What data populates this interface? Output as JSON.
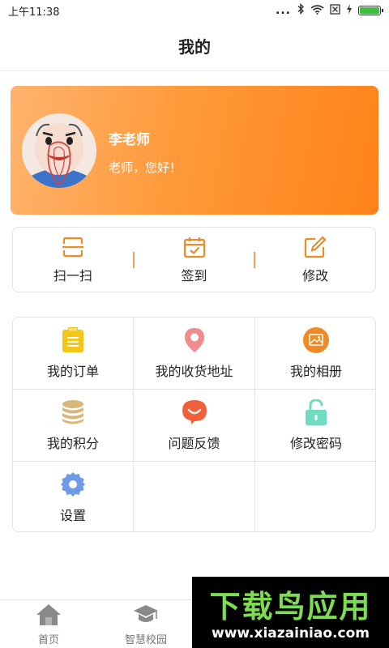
{
  "status_bar": {
    "time": "上午11:38",
    "dots": "..."
  },
  "header": {
    "title": "我的"
  },
  "profile": {
    "name": "李老师",
    "greeting": "老师，您好！"
  },
  "quick_actions": [
    {
      "label": "扫一扫",
      "icon": "scan-icon"
    },
    {
      "label": "签到",
      "icon": "calendar-check-icon"
    },
    {
      "label": "修改",
      "icon": "edit-icon"
    }
  ],
  "grid_items": [
    {
      "label": "我的订单",
      "icon": "clipboard-icon",
      "color": "#f5c518"
    },
    {
      "label": "我的收货地址",
      "icon": "location-pin-icon",
      "color": "#f08c8c"
    },
    {
      "label": "我的相册",
      "icon": "photo-icon",
      "color": "#f08a24"
    },
    {
      "label": "我的积分",
      "icon": "coins-icon",
      "color": "#d8b878"
    },
    {
      "label": "问题反馈",
      "icon": "feedback-bubble-icon",
      "color": "#f0603a"
    },
    {
      "label": "修改密码",
      "icon": "unlock-icon",
      "color": "#6fdcc0"
    },
    {
      "label": "设置",
      "icon": "gear-icon",
      "color": "#6e9be8"
    }
  ],
  "tab_bar": {
    "tabs": [
      {
        "label": "首页",
        "icon": "home-icon"
      },
      {
        "label": "智慧校园",
        "icon": "graduation-cap-icon"
      }
    ]
  },
  "watermark": {
    "title": "下载鸟应用",
    "url": "www.xiazainiao.com"
  },
  "colors": {
    "accent": "#f08a24",
    "card_start": "#ffb36e",
    "card_end": "#ff8218"
  }
}
